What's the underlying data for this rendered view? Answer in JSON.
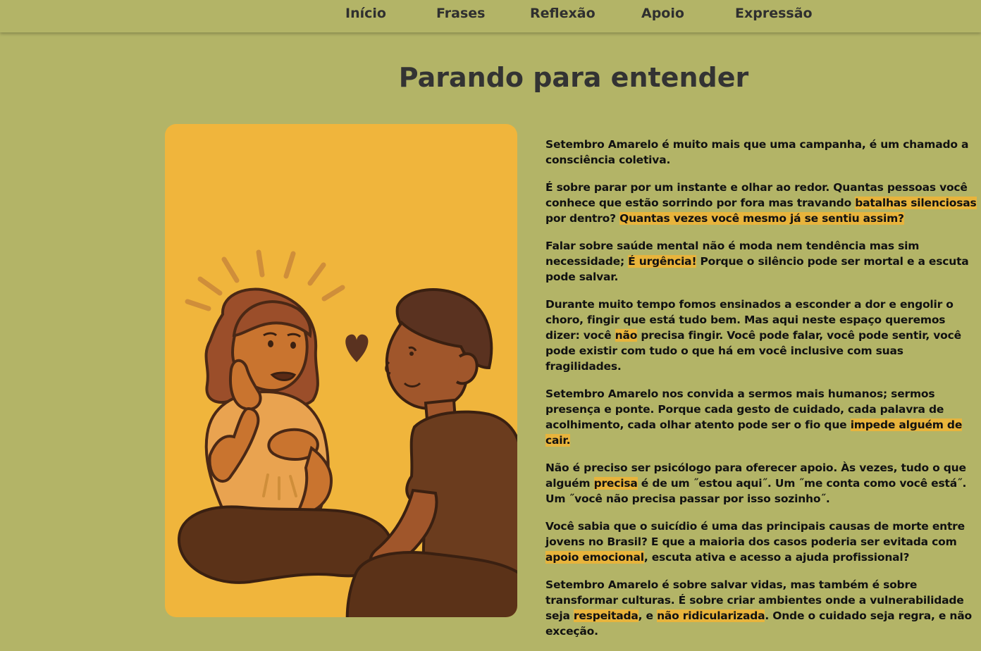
{
  "nav": {
    "items": [
      {
        "label": "Início"
      },
      {
        "label": "Frases"
      },
      {
        "label": "Reflexão"
      },
      {
        "label": "Apoio"
      },
      {
        "label": "Expressão"
      }
    ]
  },
  "section": {
    "title": "Parando para entender"
  },
  "colors": {
    "background": "#b3b467",
    "card": "#f0b53c",
    "highlight": "#e8b43c",
    "title": "#333333"
  },
  "paragraphs": [
    {
      "p1": "Setembro Amarelo é muito mais que uma campanha, é um chamado a consciência coletiva."
    },
    {
      "p1": "É sobre parar por um instante e olhar ao redor. Quantas pessoas você conhece que estão sorrindo por fora mas travando ",
      "h1": "batalhas silenciosas",
      "p2": " por dentro? ",
      "h2": "Quantas vezes você mesmo já se sentiu assim?"
    },
    {
      "p1": "Falar sobre saúde mental não é moda nem tendência mas sim necessidade; ",
      "h1": "É urgência!",
      "p2": " Porque o silêncio pode ser mortal e a escuta pode salvar."
    },
    {
      "p1": "Durante muito tempo fomos ensinados a esconder a dor e engolir o choro, fingir que está tudo bem. Mas aqui neste espaço queremos dizer: você ",
      "h1": "não",
      "p2": " precisa fingir. Você pode falar, você pode sentir, você pode existir com tudo o que há em você inclusive com suas fragilidades."
    },
    {
      "p1": "Setembro Amarelo nos convida a sermos mais humanos; sermos presença e ponte. Porque cada gesto de cuidado, cada palavra de acolhimento, cada olhar atento pode ser o fio que ",
      "h1": "impede alguém de cair."
    },
    {
      "p1": "Não é preciso ser psicólogo para oferecer apoio. Às vezes, tudo o que alguém ",
      "h1": "precisa",
      "p2": " é de um ˝estou aqui˝. Um ˝me conta como você está˝. Um ˝você não precisa passar por isso sozinho˝."
    },
    {
      "p1": "Você sabia que o suicídio é uma das principais causas de morte entre jovens no Brasil? E que a maioria dos casos poderia ser evitada com ",
      "h1": "apoio emocional",
      "p2": ", escuta ativa e acesso a ajuda profissional?"
    },
    {
      "p1": "Setembro Amarelo é sobre salvar vidas, mas também é sobre transformar culturas. É sobre criar ambientes onde a vulnerabilidade seja ",
      "h1": "respeitada",
      "p2": ", e ",
      "h2": "não ridicularizada",
      "p3": ". Onde o cuidado seja regra, e não exceção."
    }
  ]
}
